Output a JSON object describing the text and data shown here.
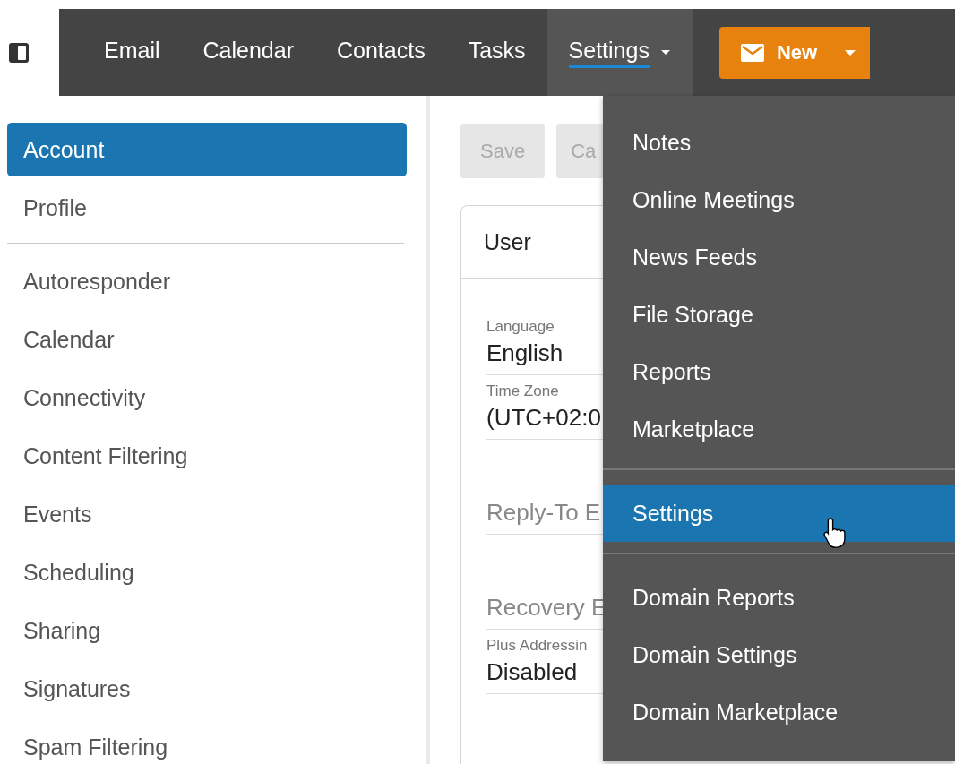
{
  "nav": {
    "items": [
      {
        "label": "Email",
        "selected": false,
        "has_menu": false
      },
      {
        "label": "Calendar",
        "selected": false,
        "has_menu": false
      },
      {
        "label": "Contacts",
        "selected": false,
        "has_menu": false
      },
      {
        "label": "Tasks",
        "selected": false,
        "has_menu": false
      },
      {
        "label": "Settings",
        "selected": true,
        "has_menu": true
      }
    ],
    "new_button": {
      "label": "New"
    }
  },
  "sidebar": {
    "groups": [
      [
        {
          "label": "Account",
          "selected": true
        },
        {
          "label": "Profile",
          "selected": false
        }
      ],
      [
        {
          "label": "Autoresponder",
          "selected": false
        },
        {
          "label": "Calendar",
          "selected": false
        },
        {
          "label": "Connectivity",
          "selected": false
        },
        {
          "label": "Content Filtering",
          "selected": false
        },
        {
          "label": "Events",
          "selected": false
        },
        {
          "label": "Scheduling",
          "selected": false
        },
        {
          "label": "Sharing",
          "selected": false
        },
        {
          "label": "Signatures",
          "selected": false
        },
        {
          "label": "Spam Filtering",
          "selected": false
        }
      ]
    ]
  },
  "toolbar": {
    "buttons": [
      {
        "label": "Save",
        "disabled": true
      },
      {
        "label": "Ca",
        "disabled": true
      }
    ]
  },
  "card": {
    "title": "User",
    "fields": [
      {
        "kind": "select",
        "label": "Language",
        "value": "English"
      },
      {
        "kind": "select",
        "label": "Time Zone",
        "value": "(UTC+02:0"
      },
      {
        "kind": "input",
        "placeholder": "Reply-To E"
      },
      {
        "kind": "input",
        "placeholder": "Recovery E"
      },
      {
        "kind": "select",
        "label": "Plus Addressin",
        "value": "Disabled"
      }
    ]
  },
  "menu": {
    "groups": [
      [
        {
          "label": "Notes",
          "selected": false
        },
        {
          "label": "Online Meetings",
          "selected": false
        },
        {
          "label": "News Feeds",
          "selected": false
        },
        {
          "label": "File Storage",
          "selected": false
        },
        {
          "label": "Reports",
          "selected": false
        },
        {
          "label": "Marketplace",
          "selected": false
        }
      ],
      [
        {
          "label": "Settings",
          "selected": true
        }
      ],
      [
        {
          "label": "Domain Reports",
          "selected": false
        },
        {
          "label": "Domain Settings",
          "selected": false
        },
        {
          "label": "Domain Marketplace",
          "selected": false
        }
      ]
    ]
  }
}
